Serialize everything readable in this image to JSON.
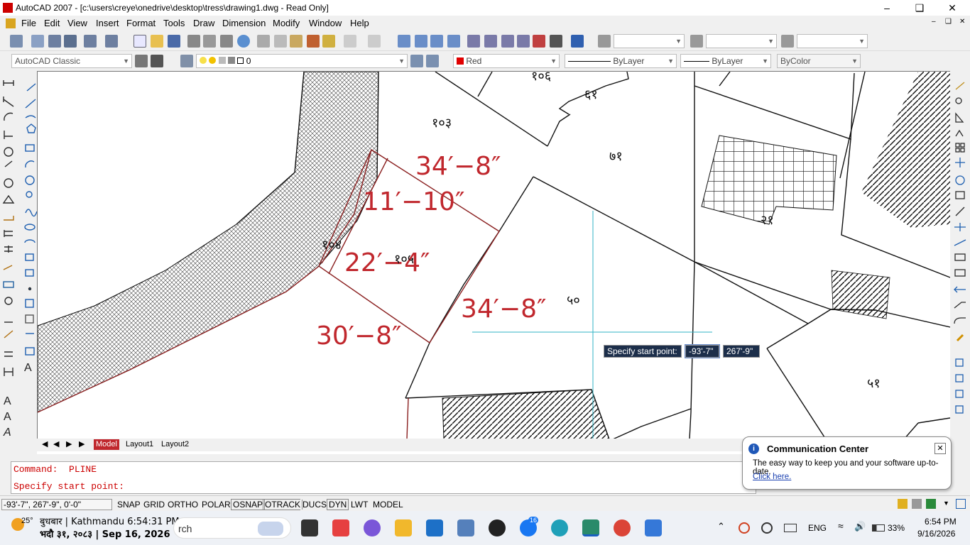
{
  "window": {
    "title": "AutoCAD 2007 - [c:\\users\\creye\\onedrive\\desktop\\tress\\drawing1.dwg - Read Only]"
  },
  "menu": [
    "File",
    "Edit",
    "View",
    "Insert",
    "Format",
    "Tools",
    "Draw",
    "Dimension",
    "Modify",
    "Window",
    "Help"
  ],
  "toolbar2": {
    "workspace": "AutoCAD Classic",
    "layer": "0",
    "color": "Red",
    "linetype": "ByLayer",
    "lineweight": "ByLayer",
    "plotstyle": "ByColor"
  },
  "drawing": {
    "dims": [
      "34′−8″",
      "11′−10″",
      "22′−4″",
      "34′−8″",
      "30′−8″"
    ],
    "parcels": [
      "१०३",
      "१०४",
      "१०५",
      "५०",
      "७१",
      "६१",
      "२१",
      "५१",
      "१०६"
    ]
  },
  "prompt": {
    "label": "Specify start point:",
    "x": "-93'-7\"",
    "y": "267'-9\""
  },
  "tabs": [
    "Model",
    "Layout1",
    "Layout2"
  ],
  "command": {
    "line1": "Command:  PLINE",
    "line2": "Specify start point:"
  },
  "status": {
    "coords": "-93'-7\", 267'-9\", 0'-0\"",
    "buttons": [
      "SNAP",
      "GRID",
      "ORTHO",
      "POLAR",
      "OSNAP",
      "OTRACK",
      "DUCS",
      "DYN",
      "LWT",
      "MODEL"
    ]
  },
  "comm": {
    "title": "Communication Center",
    "body": "The easy way to keep you and your software up-to-date.",
    "link": "Click here."
  },
  "taskbar": {
    "temp": "25°",
    "date_np1": "बुधबार | Kathmandu 6:54:31 PM",
    "date_np2": "भदौ ३१, २०८३ | Sep 16, 2026",
    "search": "rch",
    "badge": "16",
    "lang": "ENG",
    "battery": "33%",
    "time": "6:54 PM",
    "date": "9/16/2026"
  },
  "colors": {
    "dim_red": "#c0272d",
    "accent": "#0066cc"
  }
}
